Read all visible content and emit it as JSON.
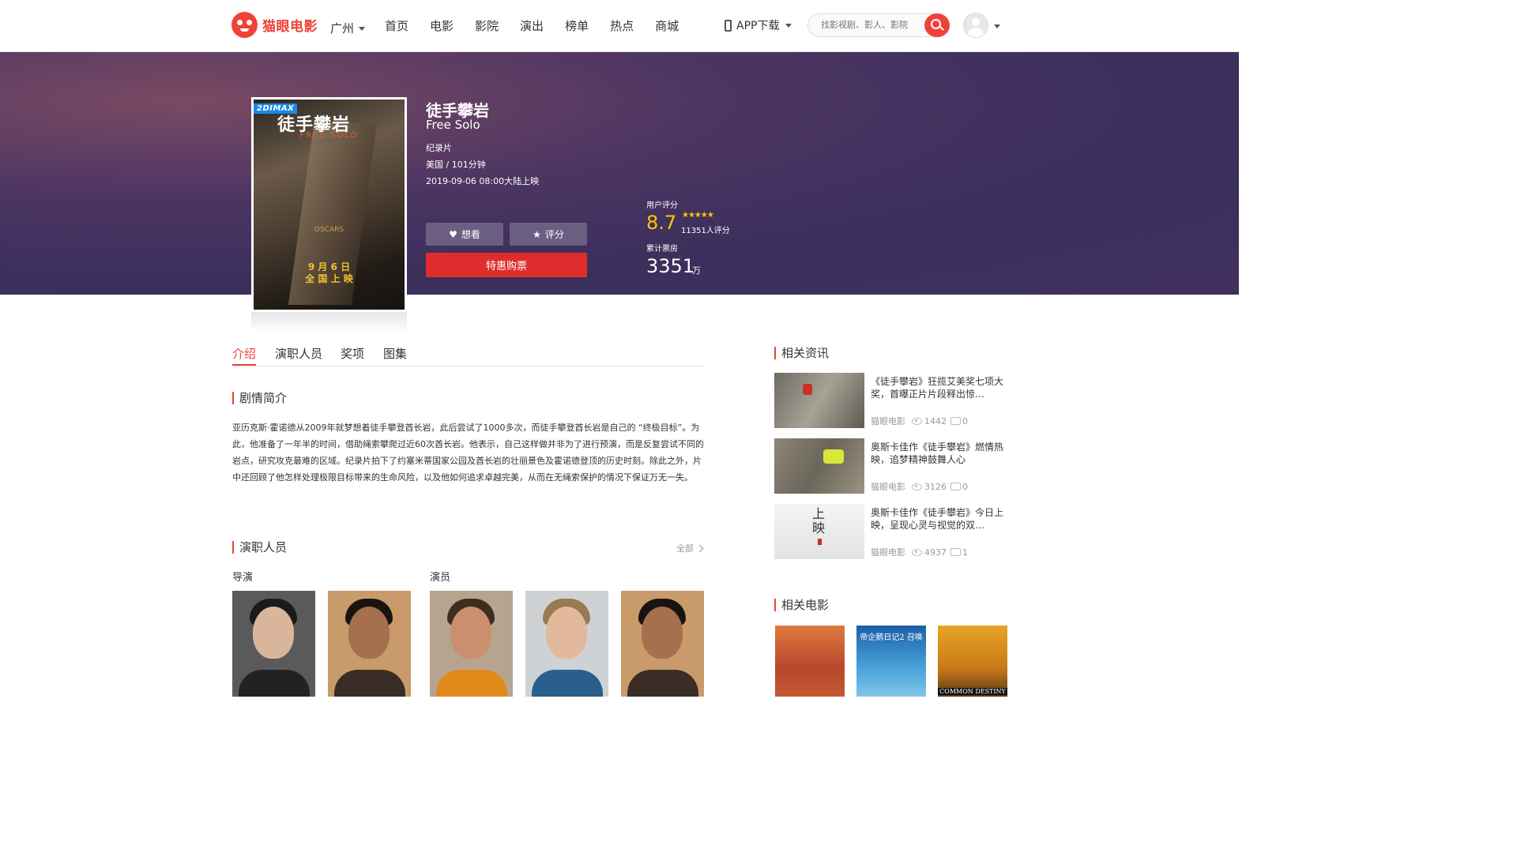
{
  "header": {
    "logo_text": "猫眼电影",
    "city": "广州",
    "nav": [
      "首页",
      "电影",
      "影院",
      "演出",
      "榜单",
      "热点",
      "商城"
    ],
    "app_download": "APP下载",
    "search_placeholder": "找影视剧、影人、影院"
  },
  "movie": {
    "title": "徒手攀岩",
    "title_en": "Free Solo",
    "genre": "纪录片",
    "country_duration": "美国 / 101分钟",
    "release": "2019-09-06 08:00大陆上映",
    "format_tag": "2DIMAX",
    "poster": {
      "title": "徒手攀岩",
      "subtitle": "FREE SOLO",
      "award": "OSCARS",
      "date_line1": "9 月 6 日",
      "date_line2": "全 国 上 映"
    },
    "want_label": "想看",
    "rate_label": "评分",
    "buy_label": "特惠购票",
    "user_score_label": "用户评分",
    "user_score": "8.7",
    "stars": "★★★★★",
    "rating_count": "11351人评分",
    "box_office_label": "累计票房",
    "box_office": "3351",
    "box_office_unit": "万"
  },
  "tabs": [
    "介绍",
    "演职人员",
    "奖项",
    "图集"
  ],
  "synopsis": {
    "heading": "剧情简介",
    "text": "亚历克斯·霍诺德从2009年就梦想着徒手攀登酋长岩，此后尝试了1000多次，而徒手攀登酋长岩是自己的 “终极目标”。为此，他准备了一年半的时间，借助绳索攀爬过近60次酋长岩。他表示，自己这样做并非为了进行预演，而是反复尝试不同的岩点，研究攻克最难的区域。纪录片拍下了约塞米蒂国家公园及酋长岩的壮丽景色及霍诺德登顶的历史时刻。除此之外，片中还回顾了他怎样处理极限目标带来的生命风险，以及他如何追求卓越完美，从而在无绳索保护的情况下保证万无一失。"
  },
  "cast": {
    "heading": "演职人员",
    "more": "全部",
    "director_label": "导演",
    "actor_label": "演员"
  },
  "news": {
    "heading": "相关资讯",
    "items": [
      {
        "title": "《徒手攀岩》狂揽艾美奖七项大奖，首曝正片片段释出惊…",
        "source": "猫眼电影",
        "views": "1442",
        "comments": "0"
      },
      {
        "title": "奥斯卡佳作《徒手攀岩》燃情热映，追梦精神鼓舞人心",
        "source": "猫眼电影",
        "views": "3126",
        "comments": "0"
      },
      {
        "title": "奥斯卡佳作《徒手攀岩》今日上映，呈现心灵与视觉的双…",
        "source": "猫眼电影",
        "views": "4937",
        "comments": "1"
      }
    ],
    "thumb3_text": "上映"
  },
  "related": {
    "heading": "相关电影",
    "movies": [
      {
        "top": "",
        "caption": ""
      },
      {
        "top": "帝企鹅日记2 召唤",
        "caption": ""
      },
      {
        "top": "",
        "caption": "COMMON DESTINY"
      }
    ]
  },
  "colors": {
    "brand": "#ef4238",
    "score": "#ffc600",
    "banner": "#3b2f5c"
  }
}
